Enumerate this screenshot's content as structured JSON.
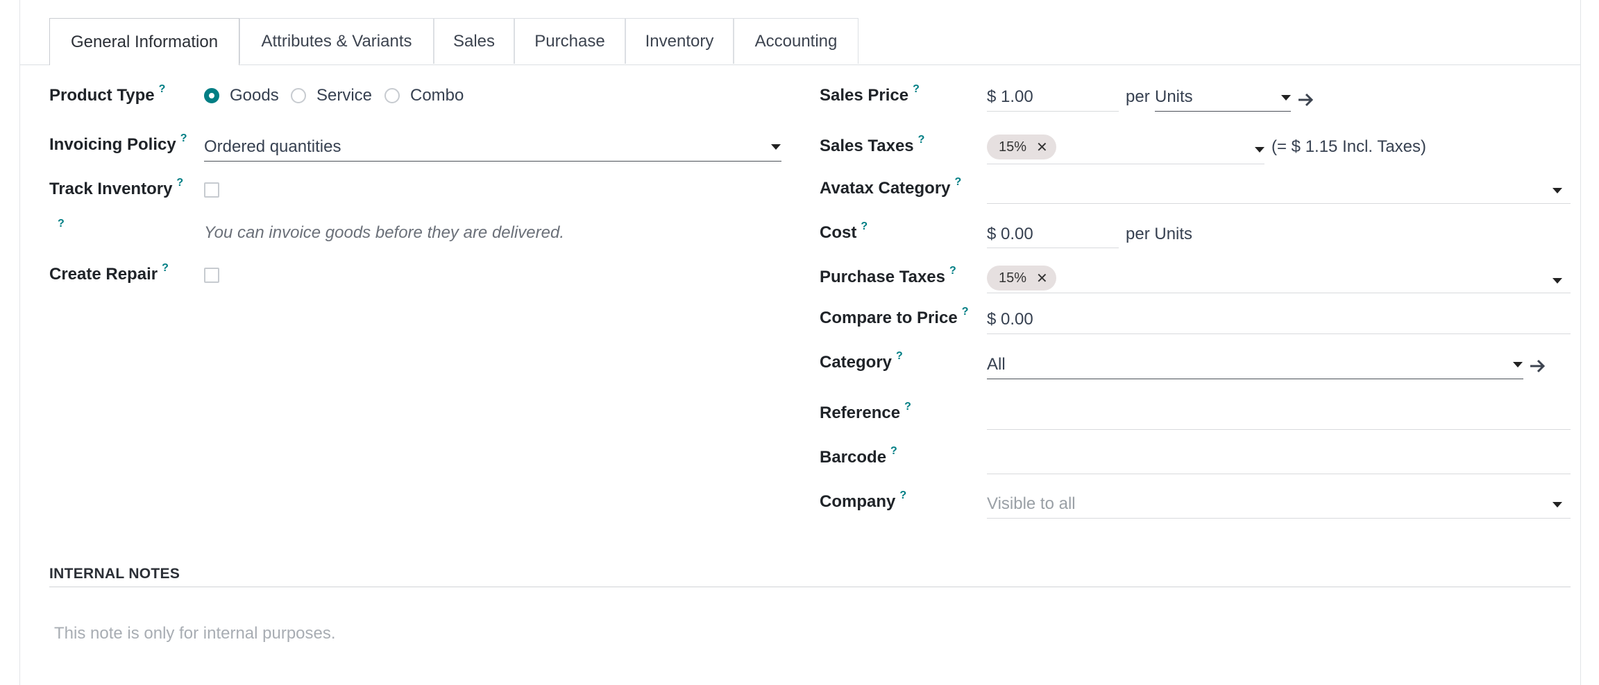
{
  "tabs": [
    {
      "label": "General Information",
      "active": true
    },
    {
      "label": "Attributes & Variants"
    },
    {
      "label": "Sales"
    },
    {
      "label": "Purchase"
    },
    {
      "label": "Inventory"
    },
    {
      "label": "Accounting"
    }
  ],
  "help_mark": "?",
  "left": {
    "product_type": {
      "label": "Product Type",
      "options": [
        "Goods",
        "Service",
        "Combo"
      ],
      "selected": "Goods"
    },
    "invoicing_policy": {
      "label": "Invoicing Policy",
      "value": "Ordered quantities"
    },
    "track_inventory": {
      "label": "Track Inventory",
      "checked": false
    },
    "hint": "You can invoice goods before they are delivered.",
    "create_repair": {
      "label": "Create Repair",
      "checked": false
    }
  },
  "right": {
    "sales_price": {
      "label": "Sales Price",
      "value": "$ 1.00",
      "per": "per",
      "unit": "Units"
    },
    "sales_taxes": {
      "label": "Sales Taxes",
      "tag": "15%",
      "incl": "(= $ 1.15 Incl. Taxes)"
    },
    "avatax_category": {
      "label": "Avatax Category",
      "value": ""
    },
    "cost": {
      "label": "Cost",
      "value": "$ 0.00",
      "per_unit": "per Units"
    },
    "purchase_taxes": {
      "label": "Purchase Taxes",
      "tag": "15%"
    },
    "compare_price": {
      "label": "Compare to Price",
      "value": "$ 0.00"
    },
    "category": {
      "label": "Category",
      "value": "All"
    },
    "reference": {
      "label": "Reference",
      "value": ""
    },
    "barcode": {
      "label": "Barcode",
      "value": ""
    },
    "company": {
      "label": "Company",
      "placeholder": "Visible to all"
    }
  },
  "notes": {
    "title": "INTERNAL NOTES",
    "placeholder": "This note is only for internal purposes."
  },
  "colors": {
    "accent": "#017e84",
    "tag_bg": "#e6e0e0"
  }
}
